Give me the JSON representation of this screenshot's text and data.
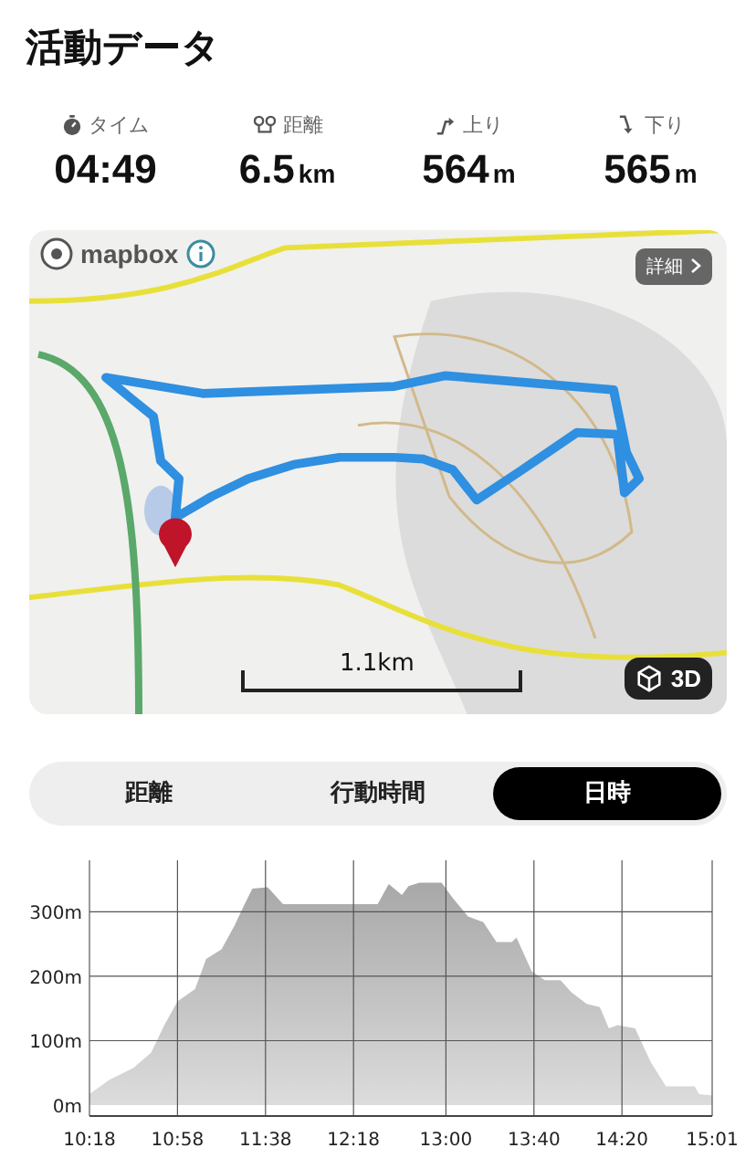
{
  "title": "活動データ",
  "stats": [
    {
      "kind": "time",
      "label": "タイム",
      "value": "04:49"
    },
    {
      "kind": "distance",
      "label": "距離",
      "value": "6.5",
      "unit": "km"
    },
    {
      "kind": "ascent",
      "label": "上り",
      "value": "564",
      "unit": "m"
    },
    {
      "kind": "descent",
      "label": "下り",
      "value": "565",
      "unit": "m"
    }
  ],
  "map": {
    "kind": "picture",
    "attribution": "mapbox",
    "details_button": "詳細",
    "scale": "1.1km",
    "view_button": "3D"
  },
  "tabs": [
    {
      "label": "距離",
      "selected": false
    },
    {
      "label": "行動時間",
      "selected": false
    },
    {
      "label": "日時",
      "selected": true
    }
  ],
  "chart_data": {
    "type": "area",
    "x": [
      618,
      627,
      638,
      646,
      652,
      658,
      666,
      671,
      678,
      684,
      688,
      692,
      699,
      706,
      749,
      754,
      760,
      763,
      768,
      778,
      783,
      790,
      797,
      803,
      810,
      812,
      819,
      825,
      832,
      837,
      844,
      850,
      854,
      858,
      866,
      873,
      880,
      893,
      895,
      901
    ],
    "series": [
      {
        "color": "#a8a8a8",
        "values": [
          17,
          39,
          58,
          81,
          124,
          161,
          180,
          227,
          242,
          279,
          308,
          336,
          338,
          312,
          312,
          343,
          326,
          340,
          345,
          345,
          322,
          293,
          284,
          253,
          253,
          260,
          208,
          194,
          194,
          175,
          157,
          152,
          119,
          124,
          119,
          67,
          29,
          29,
          17,
          15
        ]
      }
    ],
    "grid": true,
    "xlim": [
      618,
      901
    ],
    "ylim": [
      -17,
      380
    ],
    "xticks": [
      {
        "value": 618,
        "label": "10:18"
      },
      {
        "value": 658,
        "label": "10:58"
      },
      {
        "value": 698,
        "label": "11:38"
      },
      {
        "value": 738,
        "label": "12:18"
      },
      {
        "value": 780,
        "label": "13:00"
      },
      {
        "value": 820,
        "label": "13:40"
      },
      {
        "value": 860,
        "label": "14:20"
      },
      {
        "value": 901,
        "label": "15:01"
      }
    ],
    "yticks": [
      {
        "value": 0,
        "label": "0m"
      },
      {
        "value": 100,
        "label": "100m"
      },
      {
        "value": 200,
        "label": "200m"
      },
      {
        "value": 300,
        "label": "300m"
      }
    ]
  }
}
